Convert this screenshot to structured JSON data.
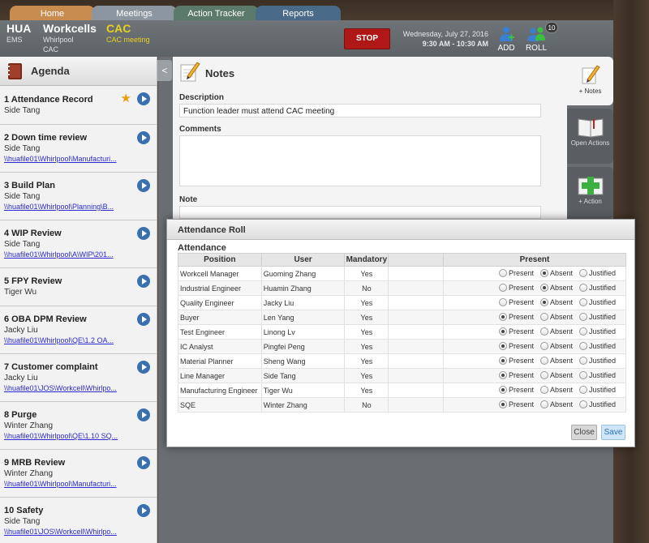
{
  "top_tabs": [
    "Home",
    "Meetings",
    "Action Tracker",
    "Reports"
  ],
  "header": {
    "plant": {
      "title": "HUA",
      "sub": "EMS"
    },
    "workcells": {
      "title": "Workcells",
      "sub1": "Whirlpool",
      "sub2": "CAC"
    },
    "meeting": {
      "title": "CAC",
      "sub": "CAC meeting"
    },
    "stop_label": "STOP",
    "date": "Wednesday, July 27, 2016",
    "time": "9:30 AM - 10:30 AM",
    "add_label": "ADD",
    "roll_label": "ROLL",
    "roll_count": "10"
  },
  "agenda": {
    "title": "Agenda",
    "items": [
      {
        "title": "1 Attendance Record",
        "owner": "Side Tang",
        "link": ""
      },
      {
        "title": "2 Down time review",
        "owner": "Side Tang",
        "link": "\\\\huafile01\\Whirlpool\\Manufacturi..."
      },
      {
        "title": "3 Build Plan",
        "owner": "Side Tang",
        "link": "\\\\huafile01\\Whirlpool\\Planning\\B..."
      },
      {
        "title": "4 WIP Review",
        "owner": "Side Tang",
        "link": "\\\\huafile01\\Whirlpool\\A\\WIP\\201..."
      },
      {
        "title": "5 FPY Review",
        "owner": "Tiger Wu",
        "link": ""
      },
      {
        "title": "6 OBA DPM Review",
        "owner": "Jacky Liu",
        "link": "\\\\huafile01\\Whirlpool\\QE\\1.2 OA..."
      },
      {
        "title": "7 Customer complaint",
        "owner": "Jacky Liu",
        "link": "\\\\huafile01\\JOS\\Workcell\\Whirlpo..."
      },
      {
        "title": "8 Purge",
        "owner": "Winter Zhang",
        "link": "\\\\huafile01\\Whirlpool\\QE\\1.10 SQ..."
      },
      {
        "title": "9 MRB Review",
        "owner": "Winter Zhang",
        "link": "\\\\huafile01\\Whirlpool\\Manufacturi..."
      },
      {
        "title": "10 Safety",
        "owner": "Side Tang",
        "link": "\\\\huafile01\\JOS\\Workcell\\Whirlpo..."
      }
    ]
  },
  "collapse_label": "<",
  "notes": {
    "title": "Notes",
    "description_label": "Description",
    "description_value": "Function leader must attend CAC meeting",
    "comments_label": "Comments",
    "comments_value": "",
    "note_label": "Note"
  },
  "side_panel": {
    "notes_label": "+ Notes",
    "open_actions_label": "Open Actions",
    "action_label": "+ Action"
  },
  "dialog": {
    "title": "Attendance Roll",
    "subtitle": "Attendance",
    "columns": [
      "Position",
      "User",
      "Mandatory",
      "Present"
    ],
    "options": [
      "Present",
      "Absent",
      "Justified"
    ],
    "rows": [
      {
        "position": "Workcell Manager",
        "user": "Guoming Zhang",
        "mandatory": "Yes",
        "present": "Absent"
      },
      {
        "position": "Industrial Engineer",
        "user": "Huamin Zhang",
        "mandatory": "No",
        "present": "Absent"
      },
      {
        "position": "Quality Engineer",
        "user": "Jacky Liu",
        "mandatory": "Yes",
        "present": "Absent"
      },
      {
        "position": "Buyer",
        "user": "Len Yang",
        "mandatory": "Yes",
        "present": "Present"
      },
      {
        "position": "Test Engineer",
        "user": "Linong Lv",
        "mandatory": "Yes",
        "present": "Present"
      },
      {
        "position": "IC Analyst",
        "user": "Pingfei Peng",
        "mandatory": "Yes",
        "present": "Present"
      },
      {
        "position": "Material Planner",
        "user": "Sheng Wang",
        "mandatory": "Yes",
        "present": "Present"
      },
      {
        "position": "Line Manager",
        "user": "Side Tang",
        "mandatory": "Yes",
        "present": "Present"
      },
      {
        "position": "Manufacturing Engineer",
        "user": "Tiger Wu",
        "mandatory": "Yes",
        "present": "Present"
      },
      {
        "position": "SQE",
        "user": "Winter Zhang",
        "mandatory": "No",
        "present": "Present"
      }
    ],
    "close_label": "Close",
    "save_label": "Save"
  }
}
